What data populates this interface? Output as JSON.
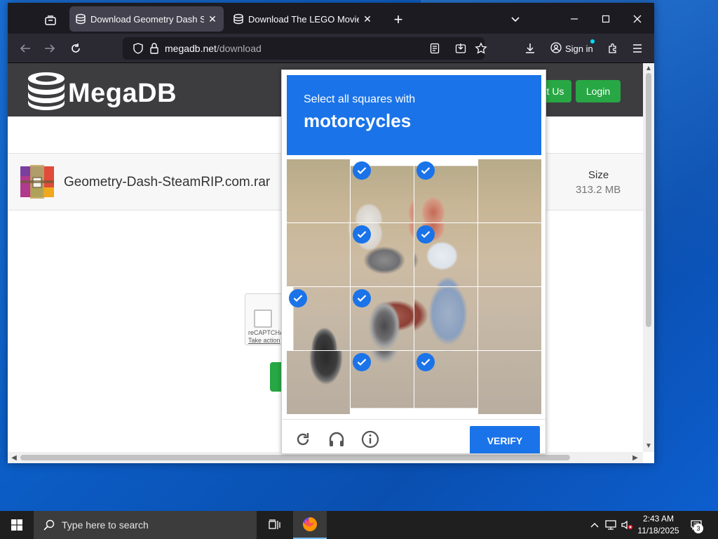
{
  "browser": {
    "tabs": [
      {
        "title": "Download Geometry Dash Steam",
        "active": true
      },
      {
        "title": "Download The LEGO Movie Vide",
        "active": false
      }
    ],
    "url_domain": "megadb.net",
    "url_path": "/download",
    "signin_label": "Sign in"
  },
  "site": {
    "logo": "MegaDB",
    "contact_label": "t Us",
    "login_label": "Login",
    "file_name": "Geometry-Dash-SteamRIP.com.rar",
    "size_label": "Size",
    "size_value": "313.2 MB",
    "captcha_brand": "reCAPTCHA",
    "captcha_link": "Take action"
  },
  "challenge": {
    "subtitle": "Select all squares with",
    "target": "motorcycles",
    "selected_tiles": [
      1,
      2,
      5,
      6,
      8,
      9,
      13,
      14
    ],
    "verify_label": "VERIFY"
  },
  "taskbar": {
    "search_placeholder": "Type here to search",
    "time": "2:43 AM",
    "date": "11/18/2025",
    "notification_count": "3"
  },
  "colors": {
    "accent_blue": "#1a73e8",
    "site_green": "#28a745",
    "browser_dark": "#1c1b22"
  }
}
